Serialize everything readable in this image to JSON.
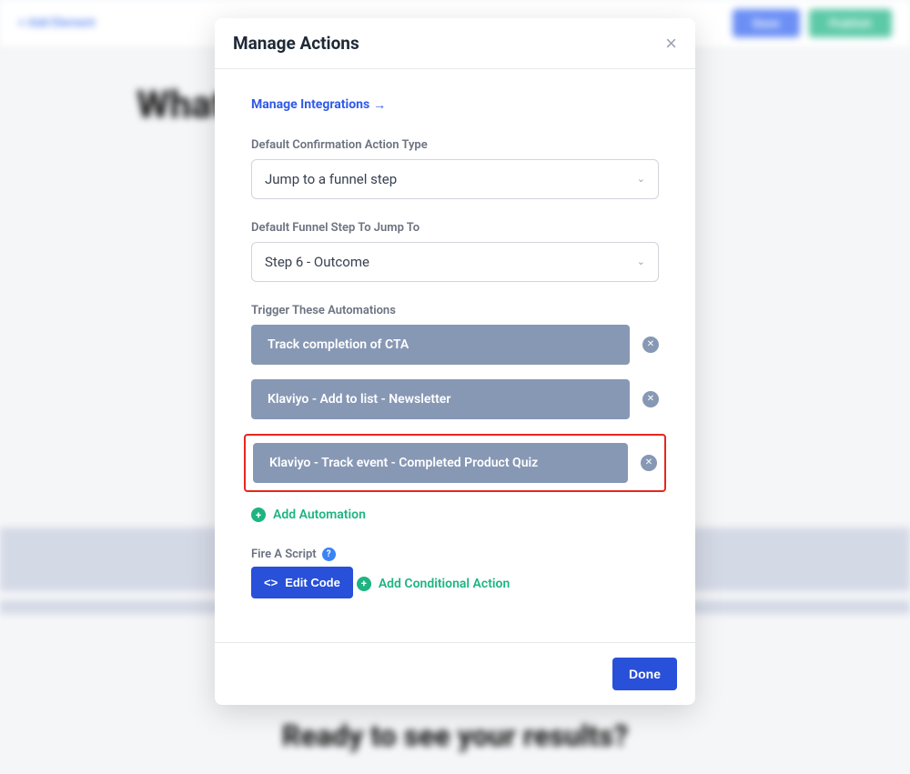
{
  "toolbar": {
    "add_element": "+ Add Element",
    "save": "Save",
    "publish": "Publish"
  },
  "background": {
    "heading1": "What",
    "heading2": "Ready to see your results?"
  },
  "modal": {
    "title": "Manage Actions",
    "manage_integrations": "Manage Integrations",
    "confirmation_label": "Default Confirmation Action Type",
    "confirmation_value": "Jump to a funnel step",
    "funnel_step_label": "Default Funnel Step To Jump To",
    "funnel_step_value": "Step 6 - Outcome",
    "trigger_label": "Trigger These Automations",
    "automations": [
      {
        "label": "Track completion of CTA"
      },
      {
        "label": "Klaviyo - Add to list - Newsletter"
      },
      {
        "label": "Klaviyo - Track event - Completed Product Quiz"
      }
    ],
    "add_automation": "Add Automation",
    "fire_script_label": "Fire A Script",
    "edit_code": "Edit Code",
    "add_conditional": "Add Conditional Action",
    "done": "Done"
  }
}
